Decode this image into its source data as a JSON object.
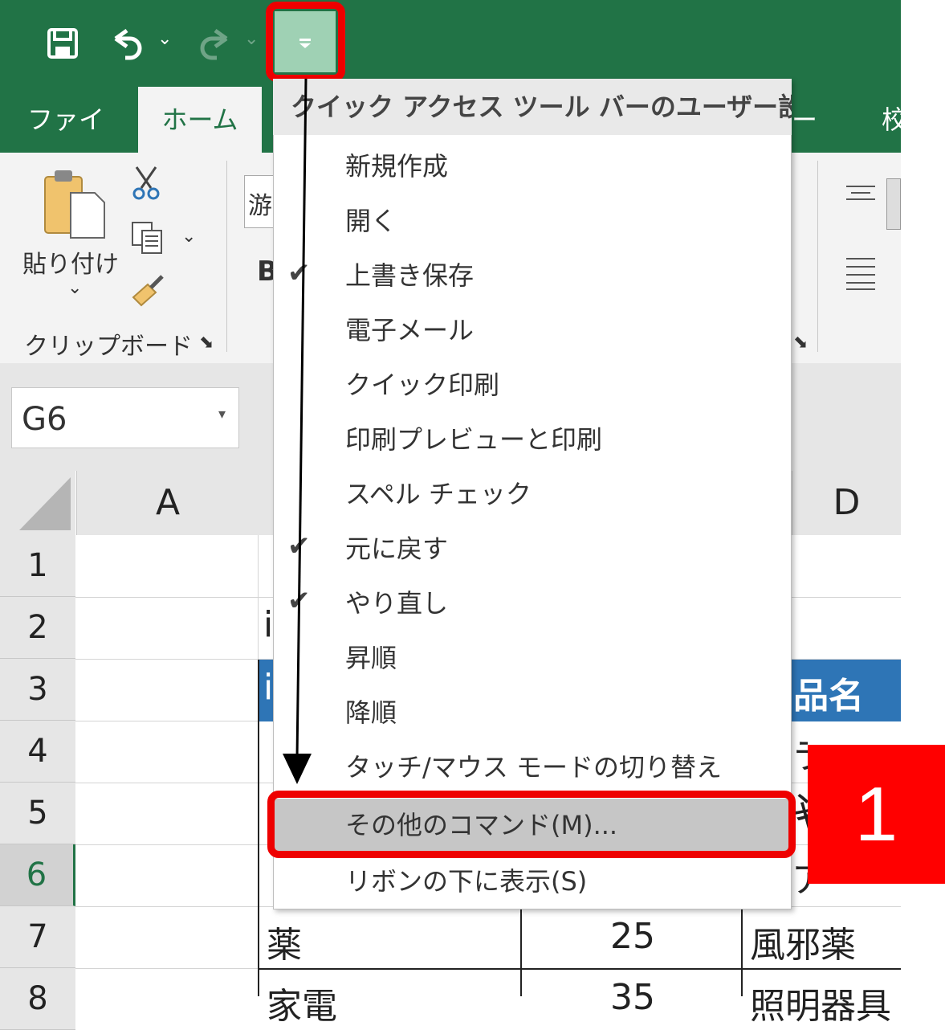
{
  "qat": {
    "save_icon": "save-icon",
    "undo_icon": "undo-icon",
    "redo_icon": "redo-icon",
    "customize_icon": "customize-qat-icon"
  },
  "tabs": [
    "ファイル",
    "ホーム",
    "ータ",
    "校"
  ],
  "ribbon": {
    "paste_label": "貼り付け",
    "clipboard_group": "クリップボード",
    "font_partial": "游",
    "bold_partial": "B"
  },
  "name_box": {
    "value": "G6"
  },
  "columns": [
    "A",
    "D"
  ],
  "rows": [
    "1",
    "2",
    "3",
    "4",
    "5",
    "6",
    "7",
    "8"
  ],
  "table": {
    "header_partial": "品名",
    "row7": {
      "b": "薬",
      "c": "25",
      "d": "風邪薬"
    },
    "row8": {
      "b": "家電",
      "c": "35",
      "d": "照明器具"
    },
    "row2_partial": "i",
    "row3_partial": "i",
    "row4_partial": "ラン",
    "row5_partial": "ヤ",
    "row6_partial": "ア"
  },
  "menu": {
    "title": "クイック アクセス ツール バーのユーザー設定",
    "items": [
      {
        "label": "新規作成",
        "checked": false
      },
      {
        "label": "開く",
        "checked": false
      },
      {
        "label": "上書き保存",
        "checked": true
      },
      {
        "label": "電子メール",
        "checked": false
      },
      {
        "label": "クイック印刷",
        "checked": false
      },
      {
        "label": "印刷プレビューと印刷",
        "checked": false
      },
      {
        "label": "スペル チェック",
        "checked": false
      },
      {
        "label": "元に戻す",
        "checked": true
      },
      {
        "label": "やり直し",
        "checked": true
      },
      {
        "label": "昇順",
        "checked": false
      },
      {
        "label": "降順",
        "checked": false
      },
      {
        "label": "タッチ/マウス モードの切り替え",
        "checked": false
      },
      {
        "label": "その他のコマンド(M)...",
        "checked": false
      },
      {
        "label": "リボンの下に表示(S)",
        "checked": false
      }
    ]
  },
  "callout": {
    "number": "1"
  },
  "colors": {
    "excel_green": "#217346",
    "highlight_red": "#ee0000",
    "table_blue": "#2e75b6"
  }
}
